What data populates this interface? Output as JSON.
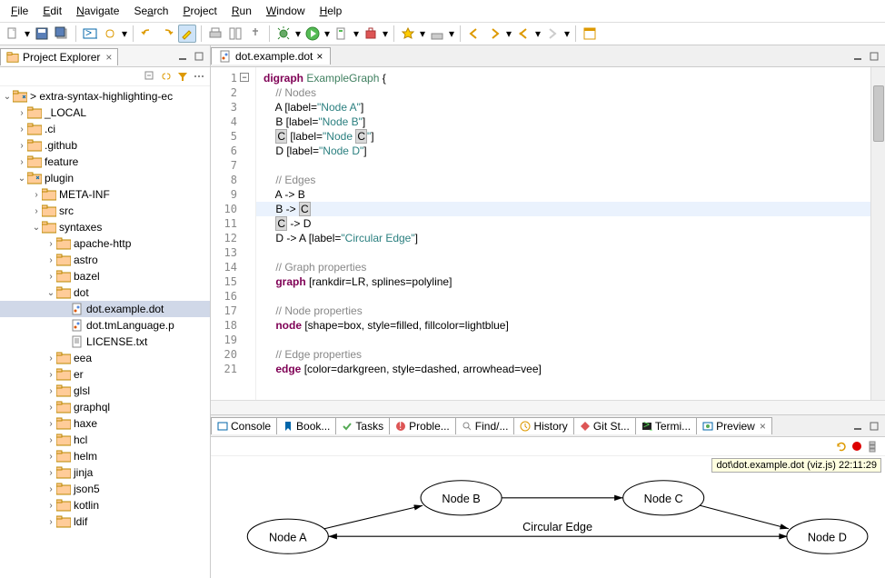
{
  "menu": [
    "File",
    "Edit",
    "Navigate",
    "Search",
    "Project",
    "Run",
    "Window",
    "Help"
  ],
  "projectExplorer": {
    "title": "Project Explorer",
    "root": "> extra-syntax-highlighting-ec",
    "items": [
      "_LOCAL",
      ".ci",
      ".github",
      "feature",
      "plugin",
      "META-INF",
      "src",
      "syntaxes",
      "apache-http",
      "astro",
      "bazel",
      "dot",
      "dot.example.dot",
      "dot.tmLanguage.p",
      "LICENSE.txt",
      "eea",
      "er",
      "glsl",
      "graphql",
      "haxe",
      "hcl",
      "helm",
      "jinja",
      "json5",
      "kotlin",
      "ldif"
    ]
  },
  "editor": {
    "filename": "dot.example.dot",
    "lines": [
      {
        "n": 1,
        "t": "kw",
        "text": "digraph ExampleGraph {"
      },
      {
        "n": 2,
        "t": "com",
        "text": "    // Nodes"
      },
      {
        "n": 3,
        "t": "node",
        "pre": "    A [label=",
        "str": "\"Node A\"",
        "post": "]"
      },
      {
        "n": 4,
        "t": "node",
        "pre": "    B [label=",
        "str": "\"Node B\"",
        "post": "]"
      },
      {
        "n": 5,
        "t": "nodec",
        "pre": "    ",
        "c": "C",
        "mid": " [label=",
        "str1": "\"Node ",
        "c2": "C",
        "str2": "\"",
        "post": "]"
      },
      {
        "n": 6,
        "t": "node",
        "pre": "    D [label=",
        "str": "\"Node D\"",
        "post": "]"
      },
      {
        "n": 7,
        "t": "blank"
      },
      {
        "n": 8,
        "t": "com",
        "text": "    // Edges"
      },
      {
        "n": 9,
        "t": "edge",
        "text": "    A -> B"
      },
      {
        "n": 10,
        "t": "edgec",
        "pre": "    B -> ",
        "c": "C",
        "hl": true
      },
      {
        "n": 11,
        "t": "edgec2",
        "pre": "    ",
        "c": "C",
        "post": " -> D"
      },
      {
        "n": 12,
        "t": "edgelabel",
        "pre": "    D -> A [label=",
        "str": "\"Circular Edge\"",
        "post": "]"
      },
      {
        "n": 13,
        "t": "blank"
      },
      {
        "n": 14,
        "t": "com",
        "text": "    // Graph properties"
      },
      {
        "n": 15,
        "t": "prop",
        "kw": "graph",
        "rest": " [rankdir=LR, splines=polyline]"
      },
      {
        "n": 16,
        "t": "blank"
      },
      {
        "n": 17,
        "t": "com",
        "text": "    // Node properties"
      },
      {
        "n": 18,
        "t": "prop",
        "kw": "node",
        "rest": " [shape=box, style=filled, fillcolor=lightblue]"
      },
      {
        "n": 19,
        "t": "blank"
      },
      {
        "n": 20,
        "t": "com",
        "text": "    // Edge properties"
      },
      {
        "n": 21,
        "t": "prop",
        "kw": "edge",
        "rest": " [color=darkgreen, style=dashed, arrowhead=vee]"
      }
    ]
  },
  "bottomTabs": [
    "Console",
    "Book...",
    "Tasks",
    "Proble...",
    "Find/...",
    "History",
    "Git St...",
    "Termi...",
    "Preview"
  ],
  "preview": {
    "tooltip": "dot\\dot.example.dot (viz.js) 22:11:29",
    "nodes": [
      "Node A",
      "Node B",
      "Node C",
      "Node D"
    ],
    "edgeLabel": "Circular Edge"
  }
}
